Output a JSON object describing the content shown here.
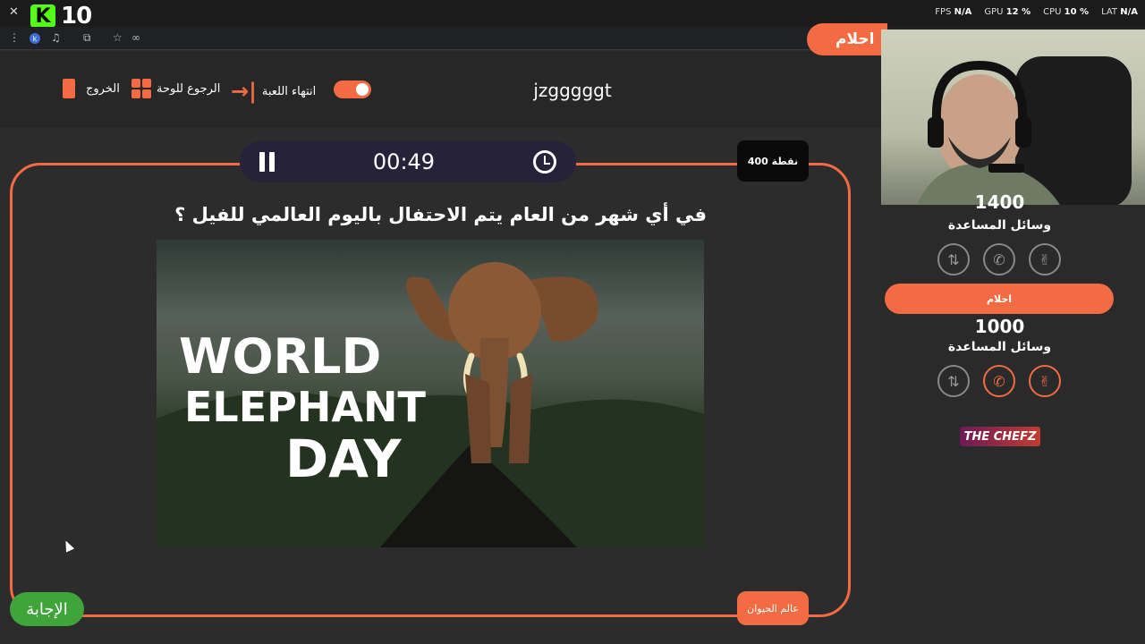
{
  "overlay": {
    "brand_number": "10",
    "perf": {
      "fps_label": "FPS",
      "fps_value": "N/A",
      "gpu_label": "GPU",
      "gpu_value": "12 %",
      "cpu_label": "CPU",
      "cpu_value": "10 %",
      "lat_label": "LAT",
      "lat_value": "N/A"
    }
  },
  "header": {
    "exit_label": "الخروج",
    "board_label": "الرجوع للوحة",
    "end_game_label": "انتهاء اللعبة",
    "game_title": "jzgggggt",
    "team1_name": "احلام"
  },
  "question": {
    "timer": "00:49",
    "points": "400 نقطة",
    "text": "في أي شهر من العام يتم الاحتفال باليوم العالمي للفيل ؟",
    "image_text": [
      "WORLD",
      "ELEPHANT",
      "DAY"
    ],
    "category": "عالم الحيوان",
    "answer_label": "الإجابة"
  },
  "teams": [
    {
      "score": "1400",
      "helpers_label": "وسائل المساعدة"
    },
    {
      "name": "احلام",
      "score": "1000",
      "helpers_label": "وسائل المساعدة"
    }
  ],
  "sponsor": "THE CHEFZ",
  "colors": {
    "accent": "#f26b43",
    "answer": "#3fa43a",
    "timer_bg": "#25223a"
  }
}
